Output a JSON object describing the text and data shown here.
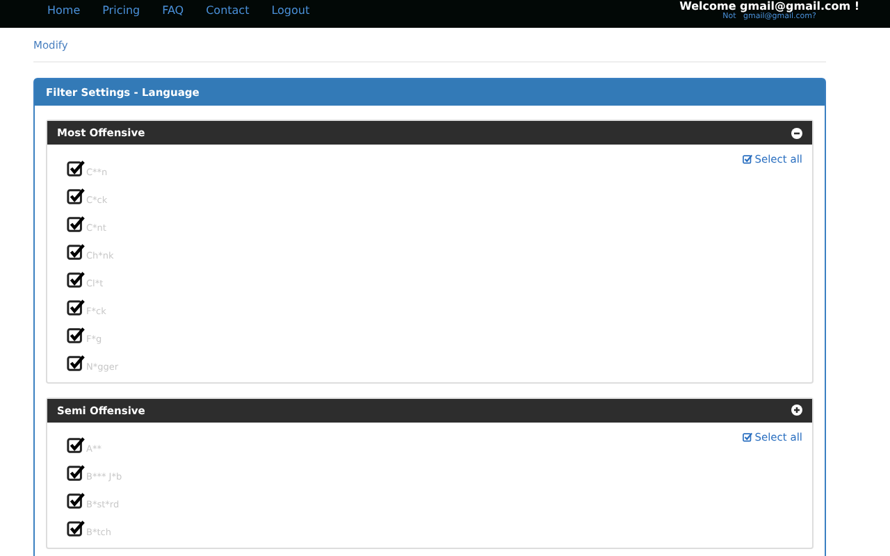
{
  "nav": {
    "links": [
      "Home",
      "Pricing",
      "FAQ",
      "Contact",
      "Logout"
    ],
    "welcome": "Welcome  gmail@gmail.com !",
    "not_user": "Not   gmail@gmail.com?"
  },
  "modify_link": "Modify",
  "panel": {
    "title": "Filter Settings - Language",
    "sections": [
      {
        "title": "Most Offensive",
        "expanded": true,
        "select_all": "Select all",
        "select_all_checked": true,
        "items": [
          {
            "label": "C**n",
            "checked": true
          },
          {
            "label": "C*ck",
            "checked": true
          },
          {
            "label": "C*nt",
            "checked": true
          },
          {
            "label": "Ch*nk",
            "checked": true
          },
          {
            "label": "Cl*t",
            "checked": true
          },
          {
            "label": "F*ck",
            "checked": true
          },
          {
            "label": "F*g",
            "checked": true
          },
          {
            "label": "N*gger",
            "checked": true
          }
        ]
      },
      {
        "title": "Semi Offensive",
        "expanded": false,
        "select_all": "Select all",
        "select_all_checked": true,
        "items": [
          {
            "label": "A**",
            "checked": true
          },
          {
            "label": "B*** J*b",
            "checked": true
          },
          {
            "label": "B*st*rd",
            "checked": true
          },
          {
            "label": "B*tch",
            "checked": true
          }
        ]
      }
    ]
  }
}
